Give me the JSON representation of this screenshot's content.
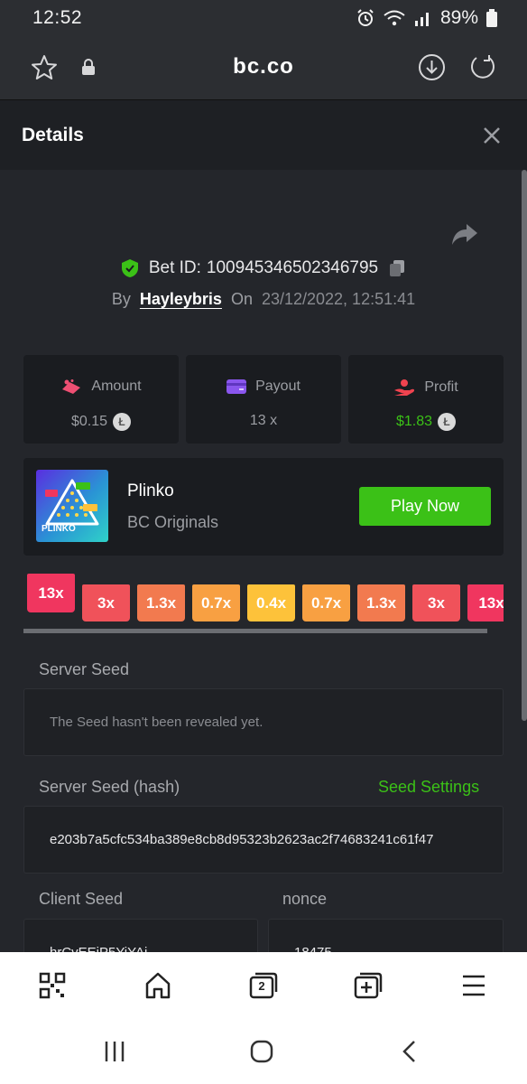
{
  "status_bar": {
    "time": "12:52",
    "battery": "89%"
  },
  "browser": {
    "url": "bc.co"
  },
  "details": {
    "title": "Details"
  },
  "bet": {
    "bet_id_label": "Bet ID:",
    "bet_id": "100945346502346795",
    "by_label": "By",
    "user": "Hayleybris",
    "on_label": "On",
    "datetime": "23/12/2022, 12:51:41"
  },
  "stats": {
    "amount": {
      "label": "Amount",
      "value": "$0.15"
    },
    "payout": {
      "label": "Payout",
      "value": "13 x"
    },
    "profit": {
      "label": "Profit",
      "value": "$1.83"
    }
  },
  "game": {
    "name": "Plinko",
    "provider": "BC Originals",
    "play_label": "Play Now",
    "thumb_text": "PLINKO"
  },
  "multipliers": [
    {
      "label": "13x",
      "color": "#f0365f",
      "active": true
    },
    {
      "label": "3x",
      "color": "#f0525a",
      "active": false
    },
    {
      "label": "1.3x",
      "color": "#f27a4f",
      "active": false
    },
    {
      "label": "0.7x",
      "color": "#f8a042",
      "active": false
    },
    {
      "label": "0.4x",
      "color": "#fdc23a",
      "active": false
    },
    {
      "label": "0.7x",
      "color": "#f8a042",
      "active": false
    },
    {
      "label": "1.3x",
      "color": "#f27a4f",
      "active": false
    },
    {
      "label": "3x",
      "color": "#f0525a",
      "active": false
    },
    {
      "label": "13x",
      "color": "#f0365f",
      "active": false
    }
  ],
  "seeds": {
    "server_seed_label": "Server Seed",
    "server_seed_value": "The Seed hasn't been revealed yet.",
    "server_seed_hash_label": "Server Seed (hash)",
    "seed_settings_label": "Seed Settings",
    "server_seed_hash_value": "e203b7a5cfc534ba389e8cb8d95323b2623ac2f74683241c61f47",
    "client_seed_label": "Client Seed",
    "client_seed_value": "hrCvEEjP5YiYAj",
    "nonce_label": "nonce",
    "nonce_value": "18475"
  },
  "bottom_nav": {
    "tabs_count": "2"
  },
  "colors": {
    "accent_green": "#3bc117",
    "profit_green": "#3bc117",
    "seed_settings": "#3bc117"
  }
}
